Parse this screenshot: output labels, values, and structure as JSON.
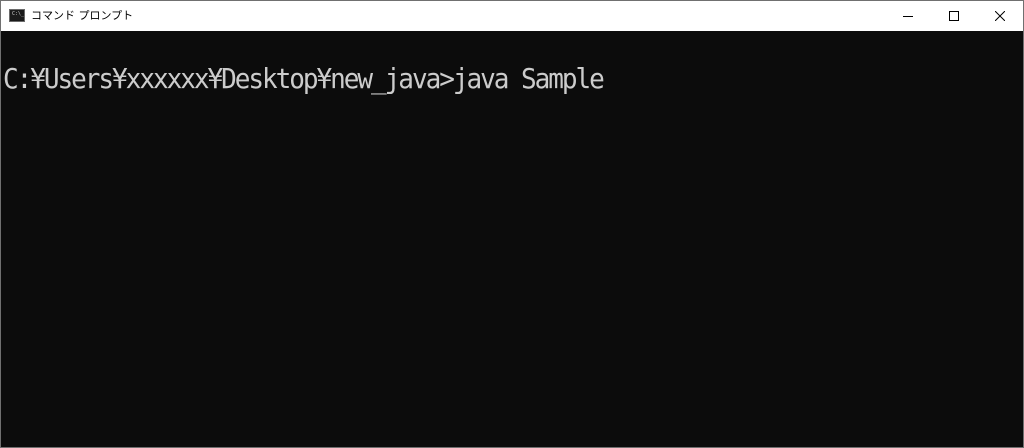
{
  "window": {
    "title": "コマンド プロンプト",
    "icon": "cmd-icon",
    "icon_text": "C:\\_",
    "controls": {
      "minimize": "minimize-icon",
      "maximize": "maximize-icon",
      "close": "close-icon"
    }
  },
  "console": {
    "background": "#0c0c0c",
    "foreground": "#cccccc",
    "lines": [
      "C:¥Users¥xxxxxx¥Desktop¥new_java>java Sample"
    ]
  }
}
